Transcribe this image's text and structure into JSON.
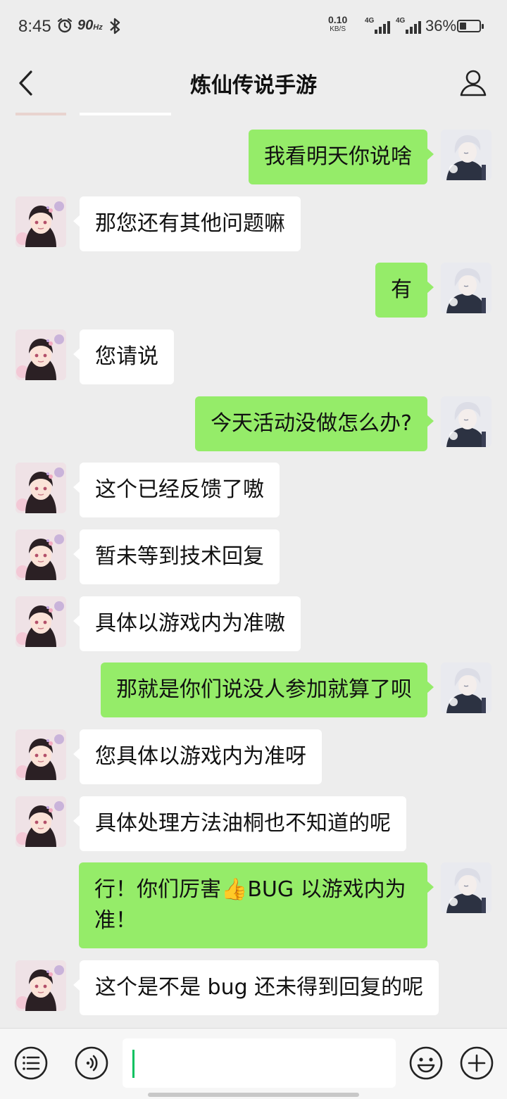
{
  "status_bar": {
    "time": "8:45",
    "refresh_rate": "90",
    "refresh_unit": "Hz",
    "net_speed": "0.10",
    "net_unit": "KB/S",
    "sim1": "4G",
    "sim2": "4G",
    "battery": "36%",
    "battery_level": 0.36
  },
  "header": {
    "title": "炼仙传说手游"
  },
  "messages": [
    {
      "side": "out",
      "text": "我看明天你说啥"
    },
    {
      "side": "in",
      "text": "那您还有其他问题嘛"
    },
    {
      "side": "out",
      "text": "有"
    },
    {
      "side": "in",
      "text": "您请说"
    },
    {
      "side": "out",
      "text": "今天活动没做怎么办?"
    },
    {
      "side": "in",
      "text": "这个已经反馈了嗷"
    },
    {
      "side": "in",
      "text": "暂未等到技术回复"
    },
    {
      "side": "in",
      "text": "具体以游戏内为准嗷"
    },
    {
      "side": "out",
      "text": "那就是你们说没人参加就算了呗"
    },
    {
      "side": "in",
      "text": "您具体以游戏内为准呀"
    },
    {
      "side": "in",
      "text": "具体处理方法油桐也不知道的呢"
    },
    {
      "side": "out",
      "text": "行！你们厉害👍BUG 以游戏内为\n准！"
    },
    {
      "side": "in",
      "text": "这个是不是 bug 还未得到回复的呢"
    }
  ],
  "input": {
    "value": ""
  },
  "colors": {
    "background": "#ededed",
    "outgoing_bubble": "#95ec69",
    "incoming_bubble": "#ffffff",
    "cursor": "#07c160"
  },
  "icons": {
    "back": "chevron-left-icon",
    "profile": "user-icon",
    "menu": "list-menu-icon",
    "voice": "voice-icon",
    "emoji": "smiley-icon",
    "more": "plus-circle-icon"
  }
}
